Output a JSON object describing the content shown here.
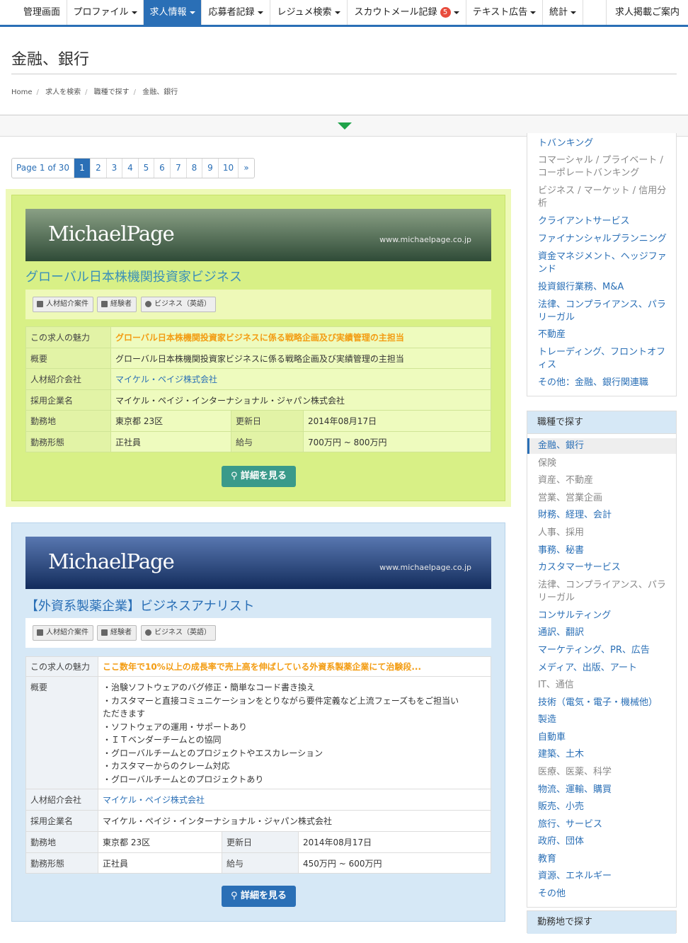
{
  "nav": {
    "items": [
      {
        "label": "管理画面"
      },
      {
        "label": "プロファイル"
      },
      {
        "label": "求人情報"
      },
      {
        "label": "応募者記録"
      },
      {
        "label": "レジュメ検索"
      },
      {
        "label": "スカウトメール記録",
        "badge": "5"
      },
      {
        "label": "テキスト広告"
      },
      {
        "label": "統計"
      },
      {
        "label": "求人掲載ご案内"
      }
    ]
  },
  "page": {
    "title": "金融、銀行"
  },
  "breadcrumb": [
    "Home",
    "求人を検索",
    "職種で探す",
    "金融、銀行"
  ],
  "pager": {
    "summary": "Page 1 of 30",
    "pages": [
      "1",
      "2",
      "3",
      "4",
      "5",
      "6",
      "7",
      "8",
      "9",
      "10"
    ],
    "next": "»"
  },
  "jobs": [
    {
      "logo": "MichaelPage",
      "logo_url": "www.michaelpage.co.jp",
      "title": "グローバル日本株機関投資家ビジネス",
      "tags": [
        "人材紹介案件",
        "経験者",
        "ビジネス（英語）"
      ],
      "labels": {
        "appeal": "この求人の魅力",
        "summary": "概要",
        "agency": "人材紹介会社",
        "company": "採用企業名",
        "location": "勤務地",
        "updated": "更新日",
        "type": "勤務形態",
        "salary": "給与"
      },
      "appeal": "グローバル日本株機関投資家ビジネスに係る戦略企画及び実績管理の主担当",
      "summary": [
        "グローバル日本株機関投資家ビジネスに係る戦略企画及び実績管理の主担当"
      ],
      "agency": "マイケル・ペイジ株式会社",
      "company": "マイケル・ペイジ・インターナショナル・ジャパン株式会社",
      "location": "東京都 23区",
      "updated": "2014年08月17日",
      "type": "正社員",
      "salary": "700万円 ~ 800万円",
      "button": "詳細を見る"
    },
    {
      "logo": "MichaelPage",
      "logo_url": "www.michaelpage.co.jp",
      "title": "【外資系製薬企業】ビジネスアナリスト",
      "tags": [
        "人材紹介案件",
        "経験者",
        "ビジネス（英語）"
      ],
      "labels": {
        "appeal": "この求人の魅力",
        "summary": "概要",
        "agency": "人材紹介会社",
        "company": "採用企業名",
        "location": "勤務地",
        "updated": "更新日",
        "type": "勤務形態",
        "salary": "給与"
      },
      "appeal": "ここ数年で10%以上の成長率で売上高を伸ばしている外資系製薬企業にて治験段...",
      "summary": [
        "・治験ソフトウェアのバグ修正・簡単なコード書き換え",
        "・カスタマーと直接コミュニケーションをとりながら要件定義など上流フェーズもをご担当い",
        "ただきます",
        "・ソフトウェアの運用・サポートあり",
        "・ＩＴベンダーチームとの協同",
        "・グローバルチームとのプロジェクトやエスカレーション",
        "・カスタマーからのクレーム対応",
        "・グローバルチームとのプロジェクトあり"
      ],
      "agency": "マイケル・ペイジ株式会社",
      "company": "マイケル・ペイジ・インターナショナル・ジャパン株式会社",
      "location": "東京都 23区",
      "updated": "2014年08月17日",
      "type": "正社員",
      "salary": "450万円 ~ 600万円",
      "button": "詳細を見る"
    }
  ],
  "sidebar_top": {
    "items": [
      "トバンキング",
      "コマーシャル / プライベート / コーポレートバンキング",
      "ビジネス / マーケット / 信用分析",
      "クライアントサービス",
      "ファイナンシャルプランニング",
      "資金マネジメント、ヘッジファンド",
      "投資銀行業務、M&A",
      "法律、コンプライアンス、パラリーガル",
      "不動産",
      "トレーディング、フロントオフィス",
      "その他：金融、銀行関連職"
    ]
  },
  "sidebar_jobs": {
    "heading": "職種で探す",
    "items": [
      "金融、銀行",
      "保険",
      "資産、不動産",
      "営業、営業企画",
      "財務、経理、会計",
      "人事、採用",
      "事務、秘書",
      "カスタマーサービス",
      "法律、コンプライアンス、パラリーガル",
      "コンサルティング",
      "通訳、翻訳",
      "マーケティング、PR、広告",
      "メディア、出版、アート",
      "IT、通信",
      "技術（電気・電子・機械他）",
      "製造",
      "自動車",
      "建築、土木",
      "医療、医薬、科学",
      "物流、運輸、購買",
      "販売、小売",
      "旅行、サービス",
      "政府、団体",
      "教育",
      "資源、エネルギー",
      "その他"
    ]
  },
  "sidebar_location": {
    "heading": "勤務地で探す"
  }
}
